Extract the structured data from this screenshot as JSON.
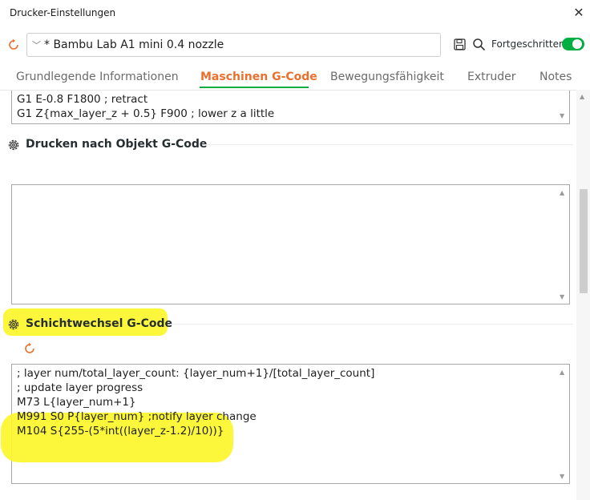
{
  "window": {
    "title": "Drucker-Einstellungen",
    "close_glyph": "✕"
  },
  "preset": {
    "chevron": "﹀",
    "name": "* Bambu Lab A1 mini 0.4 nozzle",
    "advanced_label": "Fortgeschritten",
    "advanced_enabled": true
  },
  "tabs": [
    {
      "label": "Grundlegende Informationen",
      "active": false
    },
    {
      "label": "Maschinen G-Code",
      "active": true
    },
    {
      "label": "Bewegungsfähigkeit",
      "active": false
    },
    {
      "label": "Extruder",
      "active": false
    },
    {
      "label": "Notes",
      "active": false
    }
  ],
  "top_code": {
    "lines": [
      "G1 E-0.8 F1800 ; retract",
      "G1 Z{max_layer_z + 0.5} F900 ; lower z a little"
    ]
  },
  "section_after_object": {
    "title": "Drucken nach Objekt G-Code"
  },
  "section_layer_change": {
    "title": "Schichtwechsel G-Code",
    "lines": [
      "; layer num/total_layer_count: {layer_num+1}/[total_layer_count]",
      "; update layer progress",
      "M73 L{layer_num+1}",
      "M991 S0 P{layer_num} ;notify layer change",
      "M104 S{255-(5*int((layer_z-1.2)/10))}"
    ]
  },
  "colors": {
    "accent_orange": "#eb6f2d",
    "accent_green": "#00ae42",
    "highlight_yellow": "#fdf62a"
  },
  "icons": {
    "reset": "reset-icon",
    "save": "save-icon",
    "search": "search-icon",
    "gear": "gear-icon",
    "close": "close-icon"
  }
}
